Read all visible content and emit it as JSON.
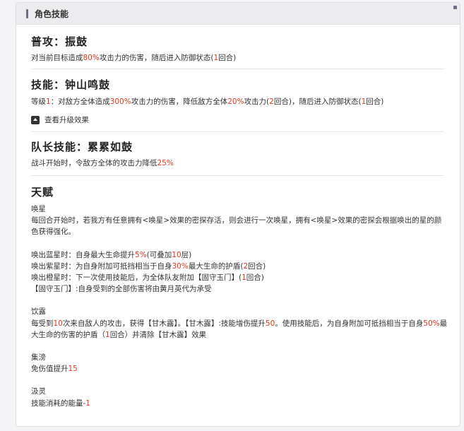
{
  "header": {
    "title": "角色技能"
  },
  "normal_attack": {
    "title": "普攻：振鼓",
    "desc": [
      "对当前目标造成",
      "80%",
      "攻击力的伤害，随后进入防御状态(",
      "1",
      "回合)"
    ]
  },
  "skill": {
    "title": "技能：钟山鸣鼓",
    "desc": [
      "等级",
      "1",
      "：对敌方全体造成",
      "300%",
      "攻击力的伤害，降低敌方全体",
      "20%",
      "攻击力(",
      "2",
      "回合)，随后进入防御状态(",
      "1",
      "回合)"
    ],
    "upgrade_label": "查看升级效果"
  },
  "leader": {
    "title": "队长技能：累累如鼓",
    "desc": [
      "战斗开始时，令敌方全体的攻击力降低",
      "25%"
    ]
  },
  "talent": {
    "title": "天赋",
    "huanxing": {
      "name": "唤星",
      "desc": "每回合开始时，若我方有任意拥有<唤星>效果的密探存活，则会进行一次唤星，拥有<唤星>效果的密探会根据唤出的星的颜色获得强化。",
      "blue": [
        "唤出蓝星时：自身最大生命提升",
        "5%",
        "(可叠加",
        "10",
        "层)"
      ],
      "purple": [
        "唤出紫星时：为自身附加可抵挡相当于自身",
        "30%",
        "最大生命的护盾(",
        "2",
        "回合)"
      ],
      "orange": [
        "唤出橙星时：下一次使用技能后，为全体队友附加【固守玉门】(",
        "1",
        "回合)"
      ],
      "guard": "【固守玉门】:自身受到的全部伤害将由黄月英代为承受"
    },
    "yinlu": {
      "name": "饮露",
      "line1": [
        "每受到",
        "10",
        "次来自敌人的攻击，获得【甘木露】。【甘木露】:技能增伤提升",
        "50",
        "。使用技能后，为自身附加可抵挡相当于自身",
        "50%",
        "最"
      ],
      "line2": [
        "大生命的伤害的护盾（",
        "1",
        "回合）并清除【甘木露】效果"
      ]
    },
    "jijiang": {
      "name": "集滂",
      "desc": [
        "免伤值提升",
        "15"
      ]
    },
    "jiling": {
      "name": "汲灵",
      "desc": [
        "技能消耗的能量-",
        "1"
      ]
    }
  },
  "colors": {
    "highlight": "#e8341c",
    "header_bg": "#ececef",
    "accent": "#6a6f86"
  }
}
